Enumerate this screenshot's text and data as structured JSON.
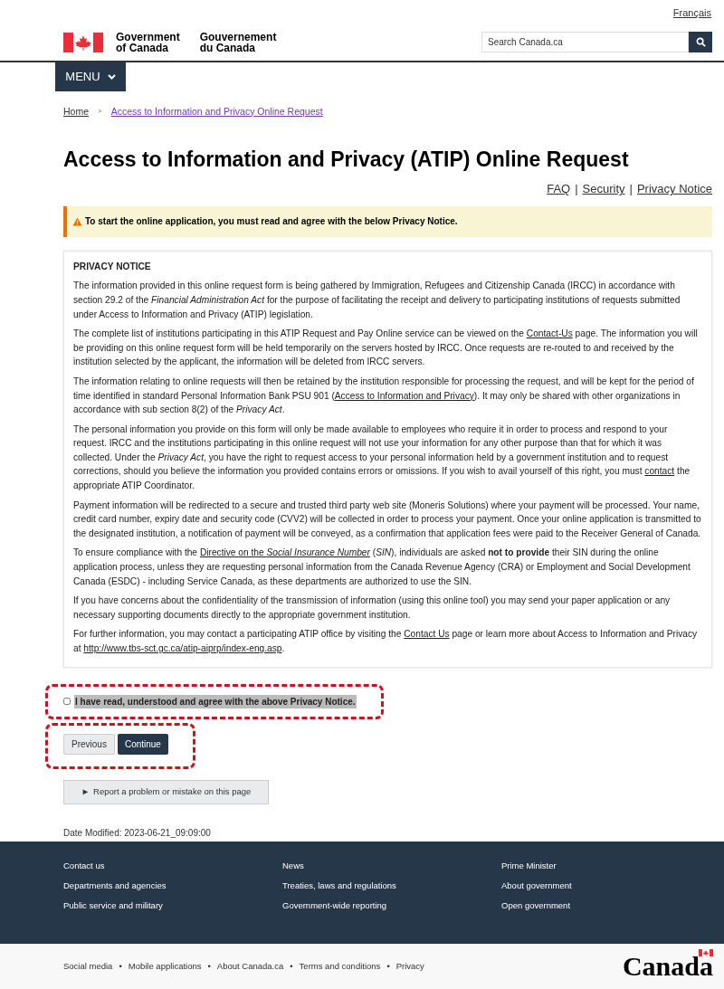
{
  "header": {
    "language_link": "Français",
    "logo_en": [
      "Government",
      "of Canada"
    ],
    "logo_fr": [
      "Gouvernement",
      "du Canada"
    ],
    "search": {
      "placeholder": "Search Canada.ca"
    }
  },
  "menu": {
    "label": "MENU"
  },
  "breadcrumb": [
    {
      "label": "Home",
      "visited": false
    },
    {
      "label": "Access to Information and Privacy Online Request",
      "visited": true
    }
  ],
  "breadcrumb_separator": ">",
  "top_links_separator": "|",
  "title": "Access to Information and Privacy (ATIP) Online Request",
  "top_links": [
    "FAQ",
    "Security",
    "Privacy Notice"
  ],
  "alert": {
    "text": "To start the online application, you must read and agree with the below Privacy Notice."
  },
  "notice": {
    "heading": "PRIVACY NOTICE",
    "paragraphs": [
      [
        {
          "kind": "text",
          "text": "The information provided in this online request form is being gathered by Immigration, Refugees and Citizenship Canada (IRCC) in accordance with section 29.2 of the *Financial Administration Act* for the purpose of facilitating the receipt and delivery to participating institutions of requests submitted under Access to Information and Privacy (ATIP) legislation."
        }
      ],
      [
        {
          "kind": "text",
          "text": "The complete list of institutions participating in this ATIP Request and Pay Online service can be viewed on the "
        },
        {
          "kind": "link",
          "text": "Contact-Us"
        },
        {
          "kind": "text",
          "text": " page. The information you will be providing on this online request form will be held temporarily on the servers hosted by IRCC. Once requests are re-routed to and received by the institution selected by the applicant, the information will be deleted from IRCC servers."
        }
      ],
      [
        {
          "kind": "text",
          "text": "The information relating to online requests will then be retained by the institution responsible for processing the request, and will be kept for the period of time identified in standard Personal Information Bank PSU 901 ("
        },
        {
          "kind": "link",
          "text": "Access to Information and Privacy"
        },
        {
          "kind": "text",
          "text": "). It may only be shared with other organizations in accordance with sub section 8(2) of the *Privacy Act*."
        }
      ],
      [
        {
          "kind": "text",
          "text": "The personal information you provide on this form will only be made available to employees who require it in order to process and respond to your request. IRCC and the institutions participating in this online request will not use your information for any other purpose than that for which it was collected. Under the *Privacy Act*, you have the right to request access to your personal information held by a government institution and to request corrections, should you believe the information you provided contains errors or omissions. If you wish to avail yourself of this right, you must "
        },
        {
          "kind": "link",
          "text": "contact"
        },
        {
          "kind": "text",
          "text": " the appropriate ATIP Coordinator."
        }
      ],
      [
        {
          "kind": "text",
          "text": "Payment information will be redirected to a secure and trusted third party web site (Moneris Solutions) where your payment will be processed. Your name, credit card number, expiry date and security code (CVV2) will be collected in order to process your payment. Once your online application is transmitted to the designated institution, a notification of payment will be conveyed, as a confirmation that application fees were paid to the Receiver General of Canada."
        }
      ],
      [
        {
          "kind": "text",
          "text": "To ensure compliance with the "
        },
        {
          "kind": "link",
          "text": "Directive on the *Social Insurance Number*"
        },
        {
          "kind": "text",
          "text": " (*SIN*), individuals are asked **not to provide** their SIN during the online application process, unless they are requesting personal information from the Canada Revenue Agency (CRA) or Employment and Social Development Canada (ESDC) - including Service Canada, as these departments are authorized to use the SIN."
        }
      ],
      [
        {
          "kind": "text",
          "text": "If you have concerns about the confidentiality of the transmission of information (using this online tool) you may send your paper application or any necessary supporting documents directly to the appropriate government institution."
        }
      ],
      [
        {
          "kind": "text",
          "text": "For further information, you may contact a participating ATIP office by visiting the "
        },
        {
          "kind": "link",
          "text": "Contact Us"
        },
        {
          "kind": "text",
          "text": " page or learn more about Access to Information and Privacy at "
        },
        {
          "kind": "link",
          "text": "http://www.tbs-sct.gc.ca/atip-aiprp/index-eng.asp"
        },
        {
          "kind": "text",
          "text": "."
        }
      ]
    ]
  },
  "agree": {
    "label": "I have read, understood and agree with the above Privacy Notice.",
    "checked": false
  },
  "buttons": [
    {
      "label": "Previous",
      "kind": "secondary"
    },
    {
      "label": "Continue",
      "kind": "primary"
    }
  ],
  "report_button": {
    "icon": "►",
    "label": "Report a problem or mistake on this page"
  },
  "date_modified": "Date Modified: 2023-06-21_09:09:00",
  "footer": {
    "columns": [
      [
        "Contact us",
        "Departments and agencies",
        "Public service and military"
      ],
      [
        "News",
        "Treaties, laws and regulations",
        "Government-wide reporting"
      ],
      [
        "Prime Minister",
        "About government",
        "Open government"
      ]
    ],
    "bottom_links": [
      "Social media",
      "Mobile applications",
      "About Canada.ca",
      "Terms and conditions",
      "Privacy"
    ],
    "bottom_separator": "•",
    "wordmark": "Canada"
  }
}
